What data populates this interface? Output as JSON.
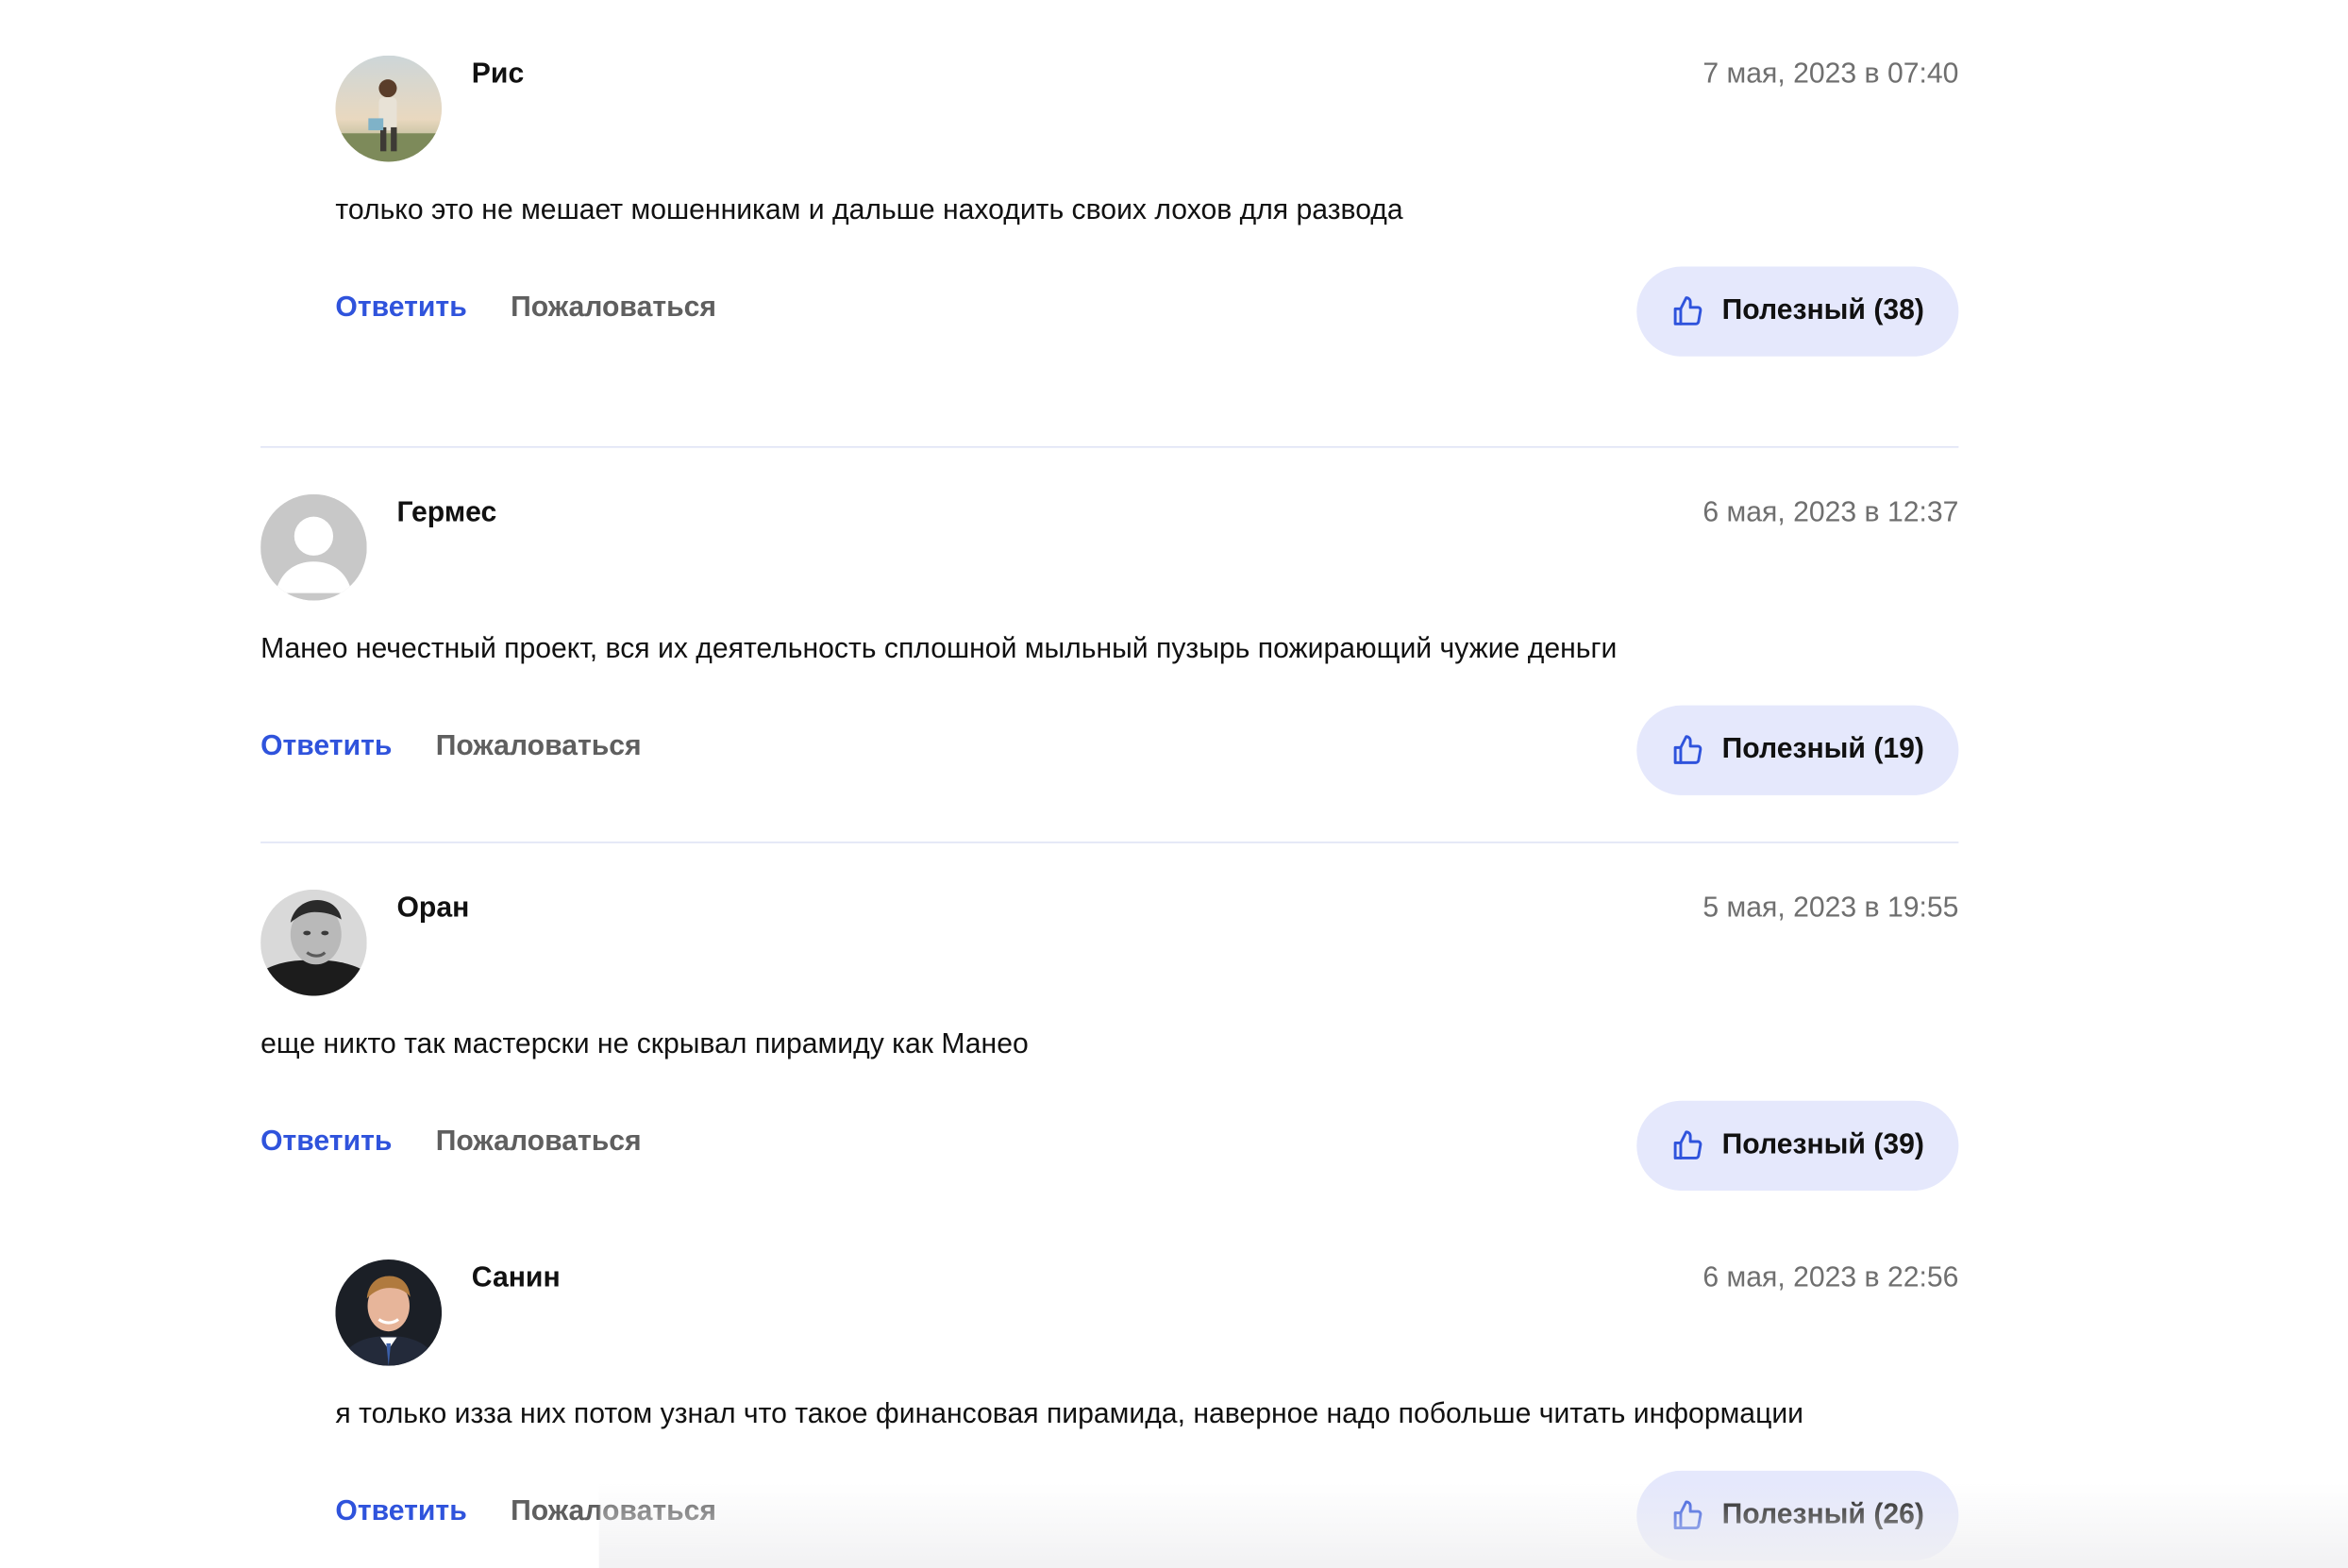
{
  "comments": [
    {
      "author": "Рис",
      "avatar_icon": "photo-avatar-beach",
      "date": "7 мая, 2023 в 07:40",
      "text": "только это не мешает мошенникам и дальше находить своих лохов для развода",
      "reply_label": "Ответить",
      "report_label": "Пожаловаться",
      "useful_label": "Полезный (38)"
    },
    {
      "author": "Гермес",
      "avatar_icon": "default-user-avatar",
      "date": "6 мая, 2023 в 12:37",
      "text": "Манео нечестный проект, вся их деятельность сплошной мыльный пузырь пожирающий чужие деньги",
      "reply_label": "Ответить",
      "report_label": "Пожаловаться",
      "useful_label": "Полезный (19)"
    },
    {
      "author": "Оран",
      "avatar_icon": "photo-avatar-bw-man",
      "date": "5 мая, 2023 в 19:55",
      "text": "еще никто так мастерски не скрывал пирамиду как Манео",
      "reply_label": "Ответить",
      "report_label": "Пожаловаться",
      "useful_label": "Полезный (39)"
    },
    {
      "author": "Санин",
      "avatar_icon": "photo-avatar-suit-man",
      "date": "6 мая, 2023 в 22:56",
      "text": "я только изза них потом узнал что такое финансовая пирамида, наверное надо побольше читать информации",
      "reply_label": "Ответить",
      "report_label": "Пожаловаться",
      "useful_label": "Полезный (26)"
    }
  ],
  "colors": {
    "accent": "#2f53dc",
    "useful_bg": "#e5e8fc",
    "muted": "#6f6f6f",
    "divider": "#dfe3f5"
  }
}
